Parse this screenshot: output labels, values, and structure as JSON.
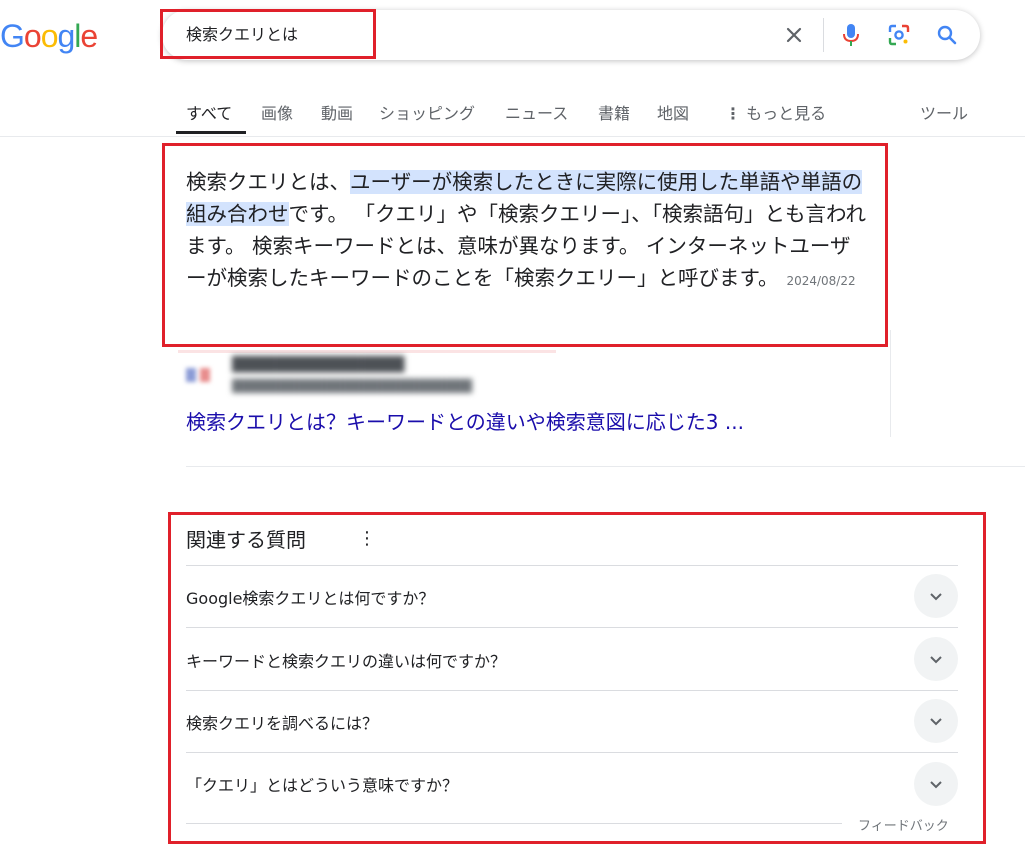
{
  "logo": {
    "letters": [
      "G",
      "o",
      "o",
      "g",
      "l",
      "e"
    ],
    "colors": [
      "#4285f4",
      "#ea4335",
      "#fbbc05",
      "#4285f4",
      "#34a853",
      "#ea4335"
    ]
  },
  "search": {
    "query": "検索クエリとは"
  },
  "icons": {
    "clear": "close-icon",
    "mic": "mic-icon",
    "lens": "lens-icon",
    "search": "search-icon"
  },
  "tabs": [
    {
      "label": "すべて"
    },
    {
      "label": "画像"
    },
    {
      "label": "動画"
    },
    {
      "label": "ショッピング"
    },
    {
      "label": "ニュース"
    },
    {
      "label": "書籍"
    },
    {
      "label": "地図"
    },
    {
      "label": "もっと見る"
    },
    {
      "label": "ツール"
    }
  ],
  "snippet": {
    "lead": "検索クエリとは、",
    "highlight": "ユーザーが検索したときに実際に使用した単語や単語の組み合わせ",
    "rest": "です。 「クエリ」や「検索クエリー」、「検索語句」とも言われます。 検索キーワードとは、意味が異なります。 インターネットユーザーが検索したキーワードのことを「検索クエリー」と呼びます。",
    "date": "2024/08/22"
  },
  "result": {
    "title": "検索クエリとは？キーワードとの違いや検索意図に応じた3 ..."
  },
  "paa": {
    "title": "関連する質問",
    "questions": [
      "Google検索クエリとは何ですか？",
      "キーワードと検索クエリの違いは何ですか？",
      "検索クエリを調べるには？",
      "「クエリ」とはどういう意味ですか？"
    ],
    "feedback": "フィードバック"
  },
  "colors": {
    "highlight_box": "#e0202a",
    "link": "#1a0dab",
    "snippet_highlight": "#d3e3fd"
  }
}
